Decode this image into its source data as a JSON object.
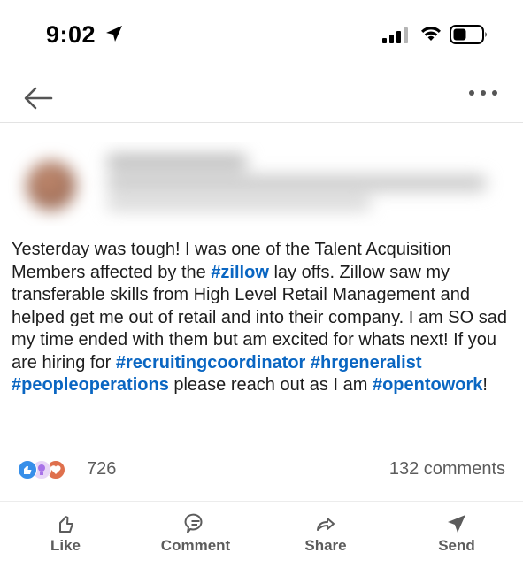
{
  "status_bar": {
    "time": "9:02"
  },
  "post": {
    "text_segments": [
      {
        "t": "Yesterday was tough! I was one of the Talent Acquisition Members affected by the ",
        "tag": false
      },
      {
        "t": "#zillow",
        "tag": true
      },
      {
        "t": " lay offs. Zillow saw my transferable skills from High Level Retail Management and helped get me out of retail and into their company. I am SO sad my time ended with them but am excited for whats next! If you are hiring for ",
        "tag": false
      },
      {
        "t": "#recruitingcoordinator",
        "tag": true
      },
      {
        "t": " ",
        "tag": false
      },
      {
        "t": "#hrgeneralist",
        "tag": true
      },
      {
        "t": " ",
        "tag": false
      },
      {
        "t": "#peopleoperations",
        "tag": true
      },
      {
        "t": " please reach out as I am ",
        "tag": false
      },
      {
        "t": "#opentowork",
        "tag": true
      },
      {
        "t": "!",
        "tag": false
      }
    ]
  },
  "social": {
    "reaction_icons": [
      "like-icon",
      "insightful-icon",
      "love-icon"
    ],
    "reaction_count": "726",
    "comments": "132 comments"
  },
  "actions": {
    "like": "Like",
    "comment": "Comment",
    "share": "Share",
    "send": "Send"
  },
  "colors": {
    "hashtag": "#0a66c2",
    "like_blue": "#378fe9",
    "love_red": "#df704d",
    "insightful_purple": "#a872e8"
  }
}
